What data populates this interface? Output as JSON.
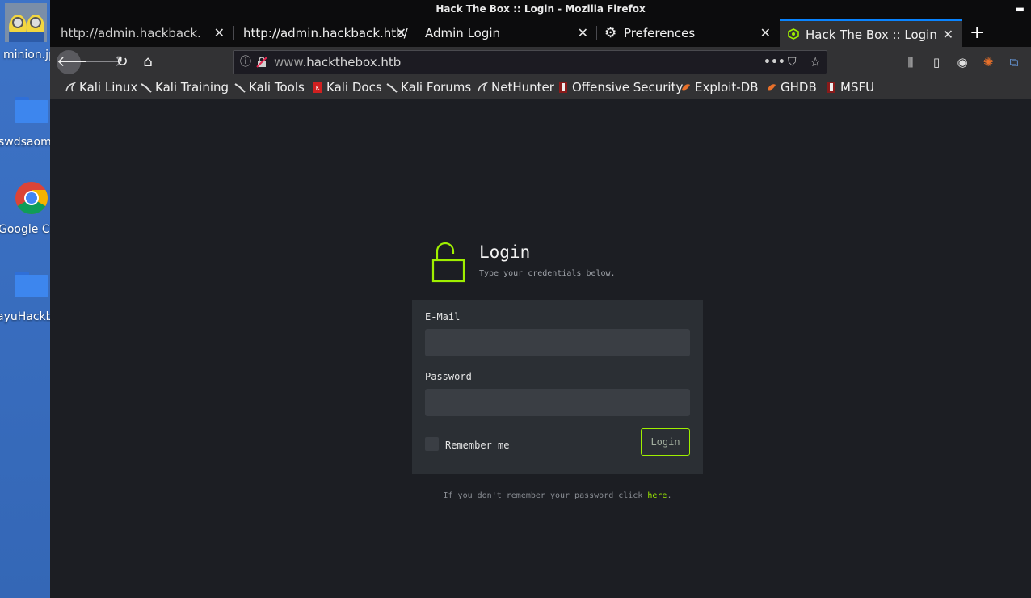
{
  "desktop": {
    "items": [
      {
        "label": "minion.jp",
        "icon": "minion-image-icon"
      },
      {
        "label": "swdsaomi",
        "icon": "folder-icon"
      },
      {
        "label": "Google Ch",
        "icon": "chrome-icon"
      },
      {
        "label": "ayuHackb",
        "icon": "folder-icon"
      }
    ]
  },
  "window": {
    "title": "Hack The Box :: Login - Mozilla Firefox"
  },
  "tabs": [
    {
      "label": "http://admin.hackback.htb/p"
    },
    {
      "label": "http://admin.hackback.htb/"
    },
    {
      "label": "Admin Login"
    },
    {
      "label": "Preferences",
      "icon": "gear-icon"
    },
    {
      "label": "Hack The Box :: Login",
      "icon": "htb-favicon",
      "active": true
    }
  ],
  "navbar": {
    "url_prefix": "www.",
    "url_domain": "hackthebox.htb"
  },
  "bookmarks": [
    {
      "label": "Kali Linux",
      "icon": "kali-dragon-icon"
    },
    {
      "label": "Kali Training",
      "icon": "kali-dragon-icon"
    },
    {
      "label": "Kali Tools",
      "icon": "kali-dragon-icon"
    },
    {
      "label": "Kali Docs",
      "icon": "kali-docs-icon"
    },
    {
      "label": "Kali Forums",
      "icon": "kali-dragon-icon"
    },
    {
      "label": "NetHunter",
      "icon": "kali-dragon-icon"
    },
    {
      "label": "Offensive Security",
      "icon": "offsec-icon"
    },
    {
      "label": "Exploit-DB",
      "icon": "exploitdb-icon"
    },
    {
      "label": "GHDB",
      "icon": "exploitdb-icon"
    },
    {
      "label": "MSFU",
      "icon": "offsec-icon"
    }
  ],
  "login": {
    "title": "Login",
    "subtitle": "Type your credentials below.",
    "email_label": "E-Mail",
    "email_value": "",
    "password_label": "Password",
    "password_value": "",
    "remember_label": "Remember me",
    "remember_checked": false,
    "button_label": "Login",
    "forgot_text": "If you don't remember your password click ",
    "forgot_link": "here",
    "forgot_end": ".",
    "accent_color": "#9fef00"
  }
}
